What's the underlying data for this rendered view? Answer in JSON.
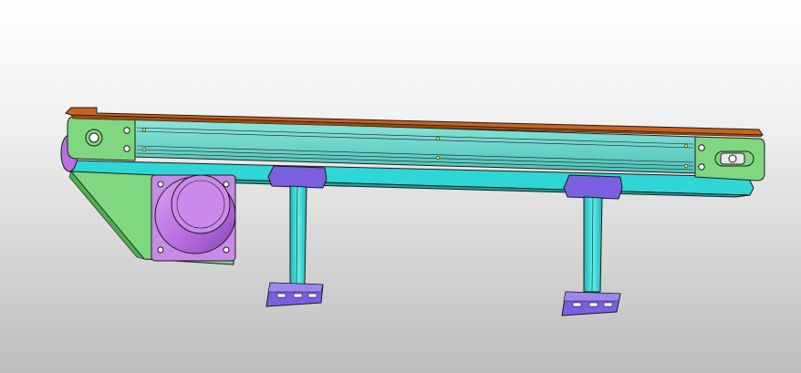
{
  "viewport": {
    "background_top": "#ffffff",
    "background_bottom": "#bdbdbd"
  },
  "model": {
    "parts": [
      {
        "name": "conveyor-belt",
        "color": "#c8641e"
      },
      {
        "name": "frame-rail",
        "color": "#5fd2c8"
      },
      {
        "name": "lower-rail",
        "color": "#2fd6d6"
      },
      {
        "name": "end-plate",
        "color": "#7fd77f"
      },
      {
        "name": "motor-bracket",
        "color": "#7fd77f"
      },
      {
        "name": "gear-motor",
        "color": "#b86fe0"
      },
      {
        "name": "support-leg",
        "color": "#2ecfcf"
      },
      {
        "name": "foot-pad",
        "color": "#7a5fe0"
      }
    ],
    "support_leg_count": 2,
    "fasteners_per_end_plate": 4
  }
}
